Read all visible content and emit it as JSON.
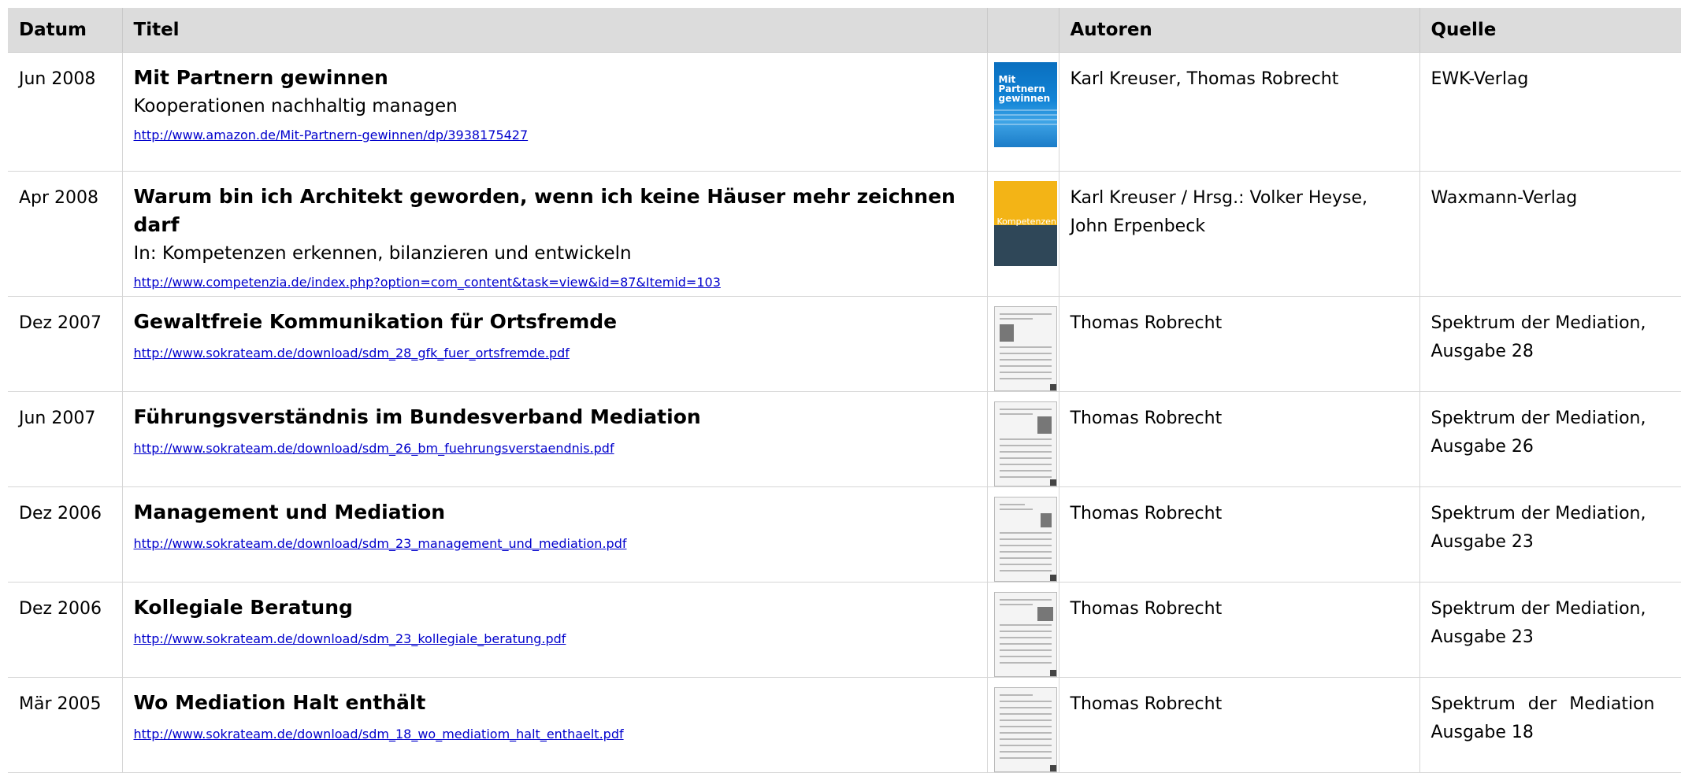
{
  "headers": {
    "datum": "Datum",
    "titel": "Titel",
    "cover": "",
    "autoren": "Autoren",
    "quelle": "Quelle"
  },
  "rows": [
    {
      "date": "Jun 2008",
      "title": "Mit Partnern gewinnen",
      "subtitle": "Kooperationen nachhaltig managen",
      "link": "http://www.amazon.de/Mit-Partnern-gewinnen/dp/3938175427",
      "authors": "Karl Kreuser,  Thomas Robrecht",
      "source": "EWK-Verlag",
      "cover_text": "Mit Partnern gewinnen",
      "cover_color": "#1284d6"
    },
    {
      "date": "Apr 2008",
      "title": "Warum bin ich Architekt geworden, wenn ich keine Häuser mehr zeichnen darf",
      "subtitle": "In: Kompetenzen erkennen, bilanzieren und entwickeln",
      "link": "http://www.competenzia.de/index.php?option=com_content&task=view&id=87&Itemid=103",
      "authors": "Karl Kreuser / Hrsg.: Volker Heyse, John Erpenbeck",
      "source": "Waxmann-Verlag",
      "cover_text": "Kompetenzen",
      "cover_color": "#f3b416"
    },
    {
      "date": "Dez 2007",
      "title": "Gewaltfreie Kommunikation für Ortsfremde",
      "link": "http://www.sokrateam.de/download/sdm_28_gfk_fuer_ortsfremde.pdf",
      "authors": "Thomas Robrecht",
      "source_line1": "Spektrum der Mediation,",
      "source_line2": "Ausgabe 28"
    },
    {
      "date": "Jun 2007",
      "title": "Führungsverständnis im Bundesverband Mediation",
      "link": "http://www.sokrateam.de/download/sdm_26_bm_fuehrungsverstaendnis.pdf",
      "authors": "Thomas Robrecht",
      "source_line1": "Spektrum der Mediation,",
      "source_line2": "Ausgabe 26"
    },
    {
      "date": "Dez 2006",
      "title": "Management und Mediation",
      "link": "http://www.sokrateam.de/download/sdm_23_management_und_mediation.pdf",
      "authors": "Thomas Robrecht",
      "source_line1": "Spektrum der Mediation,",
      "source_line2": "Ausgabe 23"
    },
    {
      "date": "Dez 2006",
      "title": "Kollegiale Beratung",
      "link": "http://www.sokrateam.de/download/sdm_23_kollegiale_beratung.pdf",
      "authors": "Thomas Robrecht",
      "source_line1": "Spektrum der Mediation,",
      "source_line2": "Ausgabe 23"
    },
    {
      "date": "Mär 2005",
      "title": "Wo Mediation Halt enthält",
      "link": "http://www.sokrateam.de/download/sdm_18_wo_mediatiom_halt_enthaelt.pdf",
      "authors": "Thomas Robrecht",
      "source_line1": "Spektrum der Mediation",
      "source_line2": "Ausgabe 18"
    }
  ],
  "colors": {
    "header_bg": "#dcdcdc",
    "link": "#0000cc",
    "grid": "#d6d6d6"
  }
}
